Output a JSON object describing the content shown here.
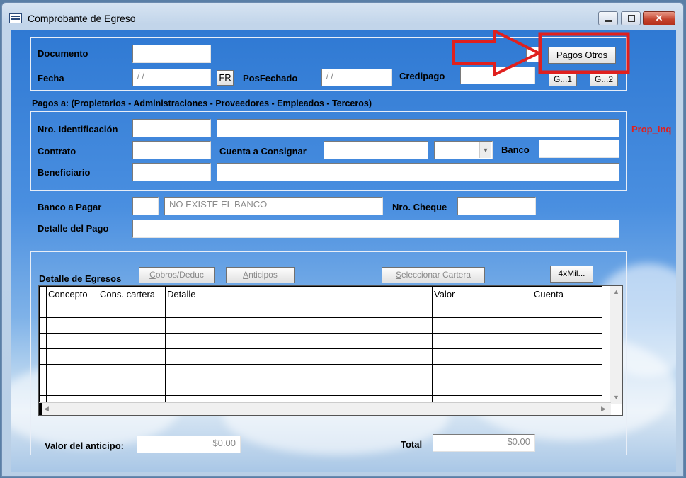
{
  "window": {
    "title": "Comprobante de Egreso"
  },
  "header": {
    "documento_label": "Documento",
    "documento_value": "",
    "pagos_otros_button": "Pagos Otros",
    "fecha_label": "Fecha",
    "fecha_value": "/ /",
    "fr_button": "FR",
    "posfechado_label": "PosFechado",
    "posfechado_value": "/ /",
    "credipago_label": "Credipago",
    "credipago_value": "",
    "g1_button": "G...1",
    "g2_button": "G...2"
  },
  "pagos_a": {
    "group_title": "Pagos a: (Propietarios - Administraciones - Proveedores - Empleados - Terceros)",
    "nro_identificacion_label": "Nro. Identificación",
    "contrato_label": "Contrato",
    "cuenta_consignar_label": "Cuenta a Consignar",
    "banco_label": "Banco",
    "beneficiario_label": "Beneficiario",
    "prop_inq_label": "Prop_Inq"
  },
  "banco": {
    "banco_pagar_label": "Banco a Pagar",
    "banco_code": "",
    "banco_name": "NO EXISTE EL BANCO",
    "nro_cheque_label": "Nro. Cheque",
    "detalle_pago_label": "Detalle del Pago"
  },
  "egresos": {
    "title": "Detalle de Egresos",
    "cobros_button_prefix": "C",
    "cobros_button_rest": "obros/Deduc",
    "anticipos_button_prefix": "A",
    "anticipos_button_rest": "nticipos",
    "seleccionar_button_prefix": "S",
    "seleccionar_button_rest": "eleccionar Cartera",
    "mil_button": "4xMil...",
    "columns": [
      "Concepto",
      "Cons. cartera",
      "Detalle",
      "Valor",
      "Cuenta"
    ]
  },
  "footer": {
    "valor_anticipo_label": "Valor del anticipo:",
    "valor_anticipo_value": "$0.00",
    "total_label": "Total",
    "total_value": "$0.00"
  },
  "colors": {
    "highlight": "#e0201e",
    "prop_inq": "#e0201e"
  }
}
